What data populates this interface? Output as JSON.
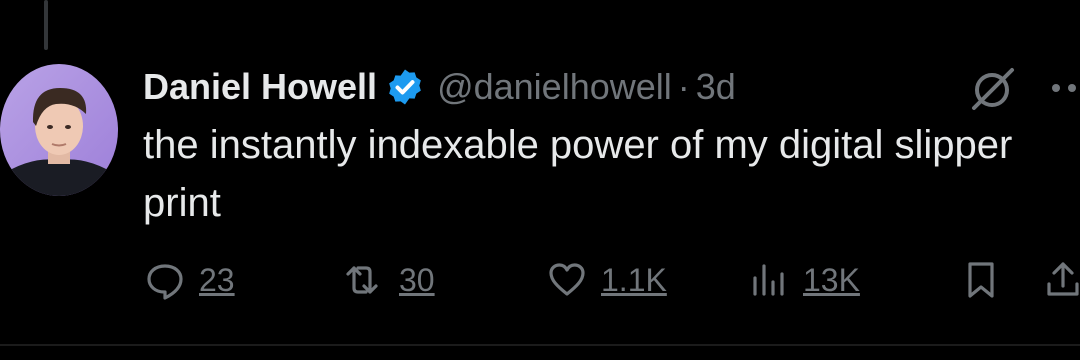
{
  "tweet": {
    "author_name": "Daniel Howell",
    "handle": "@danielhowell",
    "separator": "·",
    "time": "3d",
    "text": "the instantly indexable power of my digital slipper print",
    "verified_color": "#1d9bf0"
  },
  "actions": {
    "replies": "23",
    "reposts": "30",
    "likes": "1.1K",
    "views": "13K"
  },
  "icons": [
    "grok-icon",
    "more-icon",
    "reply-icon",
    "repost-icon",
    "like-icon",
    "views-icon",
    "bookmark-icon",
    "share-icon"
  ]
}
